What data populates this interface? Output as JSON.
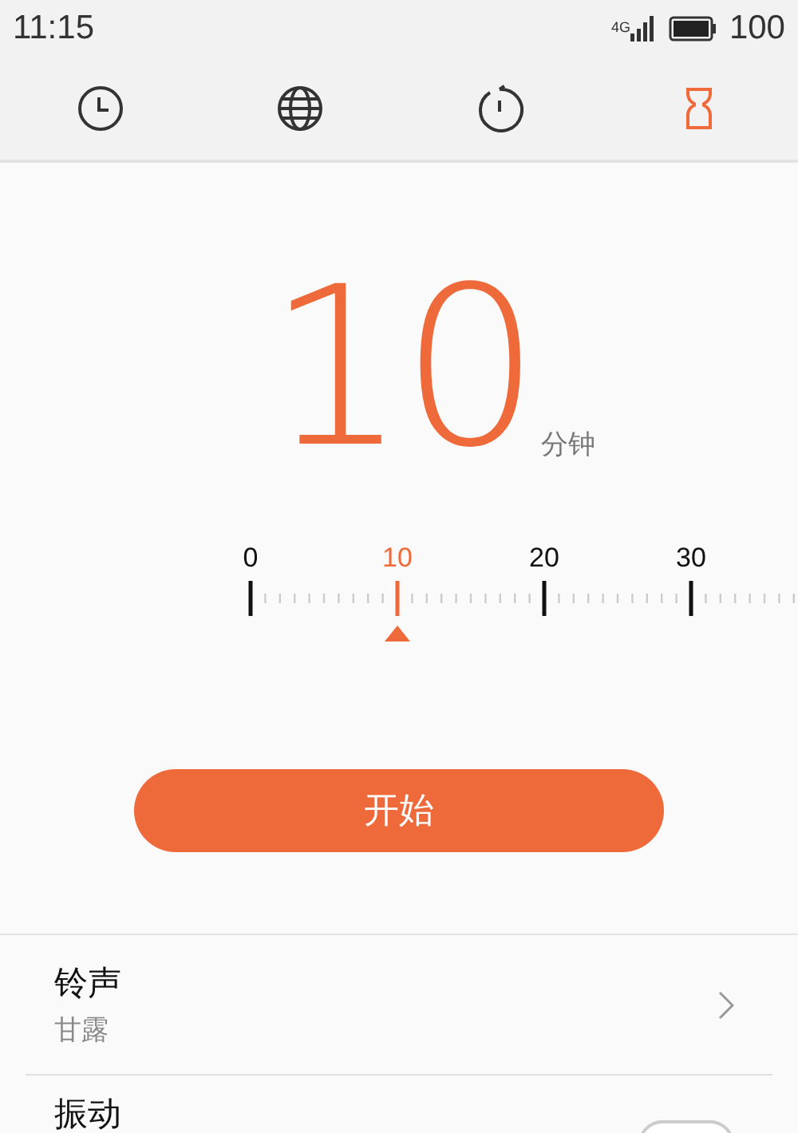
{
  "status_bar": {
    "time": "11:15",
    "network": "4G",
    "battery": "100"
  },
  "tabs": [
    {
      "kind": "clock",
      "selected": false
    },
    {
      "kind": "globe",
      "selected": false
    },
    {
      "kind": "stopwatch",
      "selected": false
    },
    {
      "kind": "timer",
      "selected": true
    }
  ],
  "timer": {
    "value": "10",
    "unit": "分钟"
  },
  "ruler": {
    "labels": [
      {
        "text": "0",
        "selected": false
      },
      {
        "text": "10",
        "selected": true
      },
      {
        "text": "20",
        "selected": false
      },
      {
        "text": "30",
        "selected": false
      }
    ]
  },
  "start_button": "开始",
  "settings": [
    {
      "kind": "link",
      "title": "铃声",
      "subtitle": "甘露"
    },
    {
      "kind": "toggle",
      "title": "振动",
      "on": false
    }
  ]
}
